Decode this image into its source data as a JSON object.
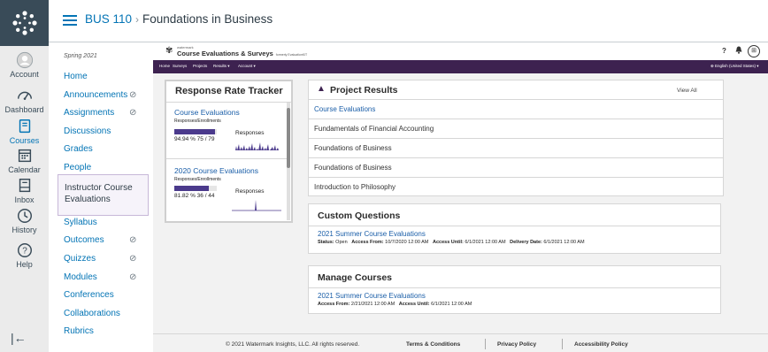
{
  "header": {
    "course_code": "BUS 110",
    "separator": "›",
    "page_title": "Foundations in Business"
  },
  "global_nav": {
    "items": [
      {
        "label": "Account",
        "icon": "user-icon"
      },
      {
        "label": "Dashboard",
        "icon": "dashboard-icon"
      },
      {
        "label": "Courses",
        "icon": "book-icon",
        "active": true
      },
      {
        "label": "Calendar",
        "icon": "calendar-icon"
      },
      {
        "label": "Inbox",
        "icon": "inbox-icon"
      },
      {
        "label": "History",
        "icon": "clock-icon"
      },
      {
        "label": "Help",
        "icon": "question-icon"
      }
    ],
    "collapse_glyph": "|←",
    "accent": "#0374b5"
  },
  "course_nav": {
    "term": "Spring 2021",
    "items": [
      {
        "label": "Home",
        "hidden": false
      },
      {
        "label": "Announcements",
        "hidden": true
      },
      {
        "label": "Assignments",
        "hidden": true
      },
      {
        "label": "Discussions",
        "hidden": false
      },
      {
        "label": "Grades",
        "hidden": false
      },
      {
        "label": "People",
        "hidden": false
      },
      {
        "label": "Syllabus",
        "hidden": false
      },
      {
        "label": "Outcomes",
        "hidden": true
      },
      {
        "label": "Quizzes",
        "hidden": true
      },
      {
        "label": "Modules",
        "hidden": true
      },
      {
        "label": "Conferences",
        "hidden": false
      },
      {
        "label": "Collaborations",
        "hidden": false
      },
      {
        "label": "Rubrics",
        "hidden": false
      }
    ],
    "active_item": "Instructor Course Evaluations",
    "hidden_icon": "⊘"
  },
  "watermark": {
    "brand_small": "watermark",
    "brand_name": "Course Evaluations & Surveys",
    "brand_note": "formerly EvaluationKIT",
    "help": "?",
    "bell": "🔔",
    "apps": "⊞",
    "nav": [
      "Home",
      "Surveys",
      "Projects",
      "Results ▾",
      "Account ▾"
    ],
    "language": "⊕ English (United States) ▾",
    "nav_color": "#3d2250"
  },
  "response_tracker": {
    "title": "Response Rate Tracker",
    "sub_label": "Responses/Enrollments",
    "responses_label": "Responses",
    "items": [
      {
        "name": "Course Evaluations",
        "rate": 0.9494,
        "text": "94.94 % 75 / 79"
      },
      {
        "name": "2020 Course Evaluations",
        "rate": 0.8182,
        "text": "81.82 % 36 / 44"
      }
    ]
  },
  "project_results": {
    "title": "Project Results",
    "view_all": "View All",
    "rows": [
      "Course Evaluations",
      "Fundamentals of Financial Accounting",
      "Foundations of Business",
      "Foundations of Business",
      "Introduction to Philosophy"
    ]
  },
  "custom_questions": {
    "title": "Custom Questions",
    "link": "2021 Summer Course Evaluations",
    "status_label": "Status:",
    "status": "Open",
    "access_from_label": "Access From:",
    "access_from": "10/7/2020 12:00 AM",
    "access_until_label": "Access Until:",
    "access_until": "6/1/2021 12:00 AM",
    "delivery_label": "Delivery Date:",
    "delivery": "6/1/2021 12:00 AM"
  },
  "manage_courses": {
    "title": "Manage Courses",
    "link": "2021 Summer Course Evaluations",
    "access_from_label": "Access From:",
    "access_from": "2/21/2021 12:00 AM",
    "access_until_label": "Access Until:",
    "access_until": "6/1/2021 12:00 AM"
  },
  "footer": {
    "copyright": "© 2021 Watermark Insights, LLC. All rights reserved.",
    "terms": "Terms & Conditions",
    "privacy": "Privacy Policy",
    "accessibility": "Accessibility Policy"
  }
}
